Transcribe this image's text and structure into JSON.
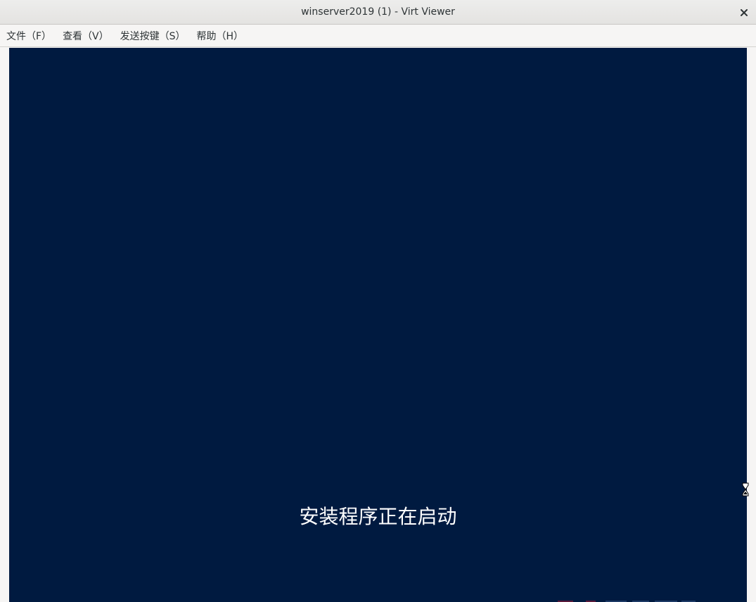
{
  "window": {
    "title": "winserver2019 (1) - Virt Viewer",
    "close_icon": "close-icon"
  },
  "menubar": {
    "items": [
      {
        "label": "文件（F）"
      },
      {
        "label": "查看（V）"
      },
      {
        "label": "发送按键（S）"
      },
      {
        "label": "帮助（H）"
      }
    ]
  },
  "vm_display": {
    "background_color": "#001a40",
    "status_text": "安装程序正在启动",
    "cursor_icon": "hourglass-cursor-icon"
  },
  "colors": {
    "titlebar": "#e8e7e6",
    "menubar": "#f6f5f4",
    "text": "#2e3436",
    "vm_background": "#001a40",
    "status_text": "#ffffff"
  }
}
